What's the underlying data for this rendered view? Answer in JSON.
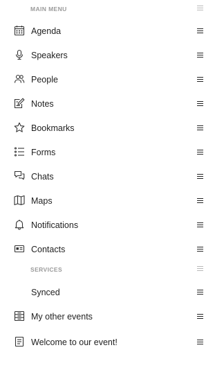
{
  "main_menu": {
    "header": "MAIN MENU",
    "items": [
      {
        "label": "Agenda",
        "icon": "calendar-icon"
      },
      {
        "label": "Speakers",
        "icon": "microphone-icon"
      },
      {
        "label": "People",
        "icon": "people-icon"
      },
      {
        "label": "Notes",
        "icon": "notes-icon"
      },
      {
        "label": "Bookmarks",
        "icon": "star-icon"
      },
      {
        "label": "Forms",
        "icon": "list-icon"
      },
      {
        "label": "Chats",
        "icon": "chat-icon"
      },
      {
        "label": "Maps",
        "icon": "map-icon"
      },
      {
        "label": "Notifications",
        "icon": "bell-icon"
      },
      {
        "label": "Contacts",
        "icon": "contact-card-icon"
      }
    ]
  },
  "services": {
    "header": "SERVICES",
    "items": [
      {
        "label": "Synced",
        "icon": ""
      },
      {
        "label": "My other events",
        "icon": "events-icon"
      },
      {
        "label": "Welcome to our event!",
        "icon": "document-icon"
      }
    ]
  },
  "colors": {
    "text": "#1f1f1f",
    "section_header": "#9a9a9a",
    "handle": "#222222",
    "handle_muted": "#b9b9b9",
    "background": "#ffffff"
  }
}
